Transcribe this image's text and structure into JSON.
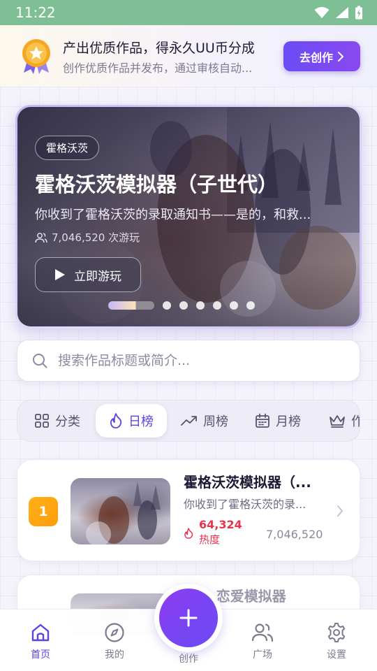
{
  "status_bar": {
    "time": "11:22"
  },
  "promo": {
    "title": "产出优质作品，得永久UU币分成",
    "subtitle": "创作优质作品并发布，通过审核自动...",
    "button_label": "去创作"
  },
  "hero": {
    "tag": "霍格沃茨",
    "title": "霍格沃茨模拟器（子世代）",
    "description": "你收到了霍格沃茨的录取通知书——是的，和救...",
    "plays": "7,046,520 次游玩",
    "play_button_label": "立即游玩",
    "carousel": {
      "total": 7,
      "active_index": 0
    }
  },
  "search": {
    "placeholder": "搜索作品标题或简介..."
  },
  "tabs": [
    {
      "label": "分类",
      "icon": "grid-icon"
    },
    {
      "label": "日榜",
      "icon": "flame-icon",
      "active": true
    },
    {
      "label": "周榜",
      "icon": "trending-up-icon"
    },
    {
      "label": "月榜",
      "icon": "calendar-icon"
    },
    {
      "label": "作",
      "icon": "crown-icon"
    }
  ],
  "ranking": [
    {
      "rank": "1",
      "title": "霍格沃茨模拟器（...",
      "description": "你收到了霍格沃茨的录...",
      "heat_value": "64,324",
      "heat_label": "热度",
      "plays": "7,046,520"
    },
    {
      "title": "...恋爱模拟器"
    }
  ],
  "bottom_nav": {
    "home": "首页",
    "mine": "我的",
    "create": "创作",
    "square": "广场",
    "settings": "设置"
  },
  "colors": {
    "accent": "#5a44e0",
    "status_bar": "#7fbf95",
    "heat": "#e8334d",
    "rank_badge": "#ffa612"
  }
}
